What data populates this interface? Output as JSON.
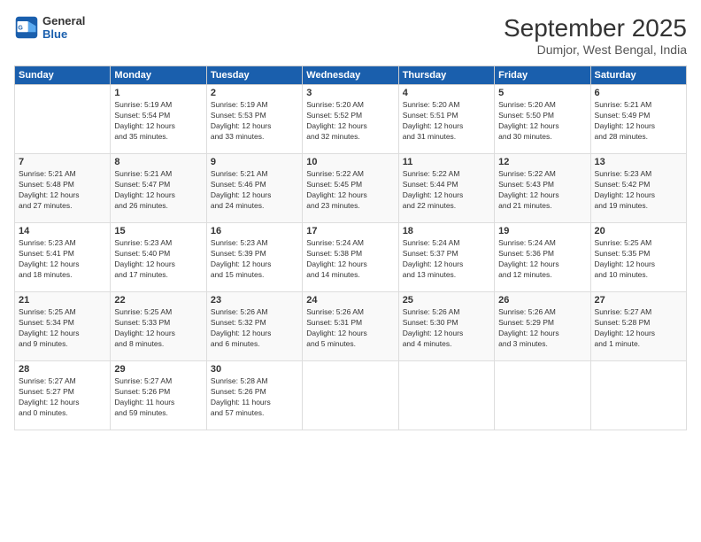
{
  "logo": {
    "line1": "General",
    "line2": "Blue"
  },
  "header": {
    "month": "September 2025",
    "location": "Dumjor, West Bengal, India"
  },
  "weekdays": [
    "Sunday",
    "Monday",
    "Tuesday",
    "Wednesday",
    "Thursday",
    "Friday",
    "Saturday"
  ],
  "weeks": [
    [
      {
        "day": "",
        "info": ""
      },
      {
        "day": "1",
        "info": "Sunrise: 5:19 AM\nSunset: 5:54 PM\nDaylight: 12 hours\nand 35 minutes."
      },
      {
        "day": "2",
        "info": "Sunrise: 5:19 AM\nSunset: 5:53 PM\nDaylight: 12 hours\nand 33 minutes."
      },
      {
        "day": "3",
        "info": "Sunrise: 5:20 AM\nSunset: 5:52 PM\nDaylight: 12 hours\nand 32 minutes."
      },
      {
        "day": "4",
        "info": "Sunrise: 5:20 AM\nSunset: 5:51 PM\nDaylight: 12 hours\nand 31 minutes."
      },
      {
        "day": "5",
        "info": "Sunrise: 5:20 AM\nSunset: 5:50 PM\nDaylight: 12 hours\nand 30 minutes."
      },
      {
        "day": "6",
        "info": "Sunrise: 5:21 AM\nSunset: 5:49 PM\nDaylight: 12 hours\nand 28 minutes."
      }
    ],
    [
      {
        "day": "7",
        "info": "Sunrise: 5:21 AM\nSunset: 5:48 PM\nDaylight: 12 hours\nand 27 minutes."
      },
      {
        "day": "8",
        "info": "Sunrise: 5:21 AM\nSunset: 5:47 PM\nDaylight: 12 hours\nand 26 minutes."
      },
      {
        "day": "9",
        "info": "Sunrise: 5:21 AM\nSunset: 5:46 PM\nDaylight: 12 hours\nand 24 minutes."
      },
      {
        "day": "10",
        "info": "Sunrise: 5:22 AM\nSunset: 5:45 PM\nDaylight: 12 hours\nand 23 minutes."
      },
      {
        "day": "11",
        "info": "Sunrise: 5:22 AM\nSunset: 5:44 PM\nDaylight: 12 hours\nand 22 minutes."
      },
      {
        "day": "12",
        "info": "Sunrise: 5:22 AM\nSunset: 5:43 PM\nDaylight: 12 hours\nand 21 minutes."
      },
      {
        "day": "13",
        "info": "Sunrise: 5:23 AM\nSunset: 5:42 PM\nDaylight: 12 hours\nand 19 minutes."
      }
    ],
    [
      {
        "day": "14",
        "info": "Sunrise: 5:23 AM\nSunset: 5:41 PM\nDaylight: 12 hours\nand 18 minutes."
      },
      {
        "day": "15",
        "info": "Sunrise: 5:23 AM\nSunset: 5:40 PM\nDaylight: 12 hours\nand 17 minutes."
      },
      {
        "day": "16",
        "info": "Sunrise: 5:23 AM\nSunset: 5:39 PM\nDaylight: 12 hours\nand 15 minutes."
      },
      {
        "day": "17",
        "info": "Sunrise: 5:24 AM\nSunset: 5:38 PM\nDaylight: 12 hours\nand 14 minutes."
      },
      {
        "day": "18",
        "info": "Sunrise: 5:24 AM\nSunset: 5:37 PM\nDaylight: 12 hours\nand 13 minutes."
      },
      {
        "day": "19",
        "info": "Sunrise: 5:24 AM\nSunset: 5:36 PM\nDaylight: 12 hours\nand 12 minutes."
      },
      {
        "day": "20",
        "info": "Sunrise: 5:25 AM\nSunset: 5:35 PM\nDaylight: 12 hours\nand 10 minutes."
      }
    ],
    [
      {
        "day": "21",
        "info": "Sunrise: 5:25 AM\nSunset: 5:34 PM\nDaylight: 12 hours\nand 9 minutes."
      },
      {
        "day": "22",
        "info": "Sunrise: 5:25 AM\nSunset: 5:33 PM\nDaylight: 12 hours\nand 8 minutes."
      },
      {
        "day": "23",
        "info": "Sunrise: 5:26 AM\nSunset: 5:32 PM\nDaylight: 12 hours\nand 6 minutes."
      },
      {
        "day": "24",
        "info": "Sunrise: 5:26 AM\nSunset: 5:31 PM\nDaylight: 12 hours\nand 5 minutes."
      },
      {
        "day": "25",
        "info": "Sunrise: 5:26 AM\nSunset: 5:30 PM\nDaylight: 12 hours\nand 4 minutes."
      },
      {
        "day": "26",
        "info": "Sunrise: 5:26 AM\nSunset: 5:29 PM\nDaylight: 12 hours\nand 3 minutes."
      },
      {
        "day": "27",
        "info": "Sunrise: 5:27 AM\nSunset: 5:28 PM\nDaylight: 12 hours\nand 1 minute."
      }
    ],
    [
      {
        "day": "28",
        "info": "Sunrise: 5:27 AM\nSunset: 5:27 PM\nDaylight: 12 hours\nand 0 minutes."
      },
      {
        "day": "29",
        "info": "Sunrise: 5:27 AM\nSunset: 5:26 PM\nDaylight: 11 hours\nand 59 minutes."
      },
      {
        "day": "30",
        "info": "Sunrise: 5:28 AM\nSunset: 5:26 PM\nDaylight: 11 hours\nand 57 minutes."
      },
      {
        "day": "",
        "info": ""
      },
      {
        "day": "",
        "info": ""
      },
      {
        "day": "",
        "info": ""
      },
      {
        "day": "",
        "info": ""
      }
    ]
  ]
}
